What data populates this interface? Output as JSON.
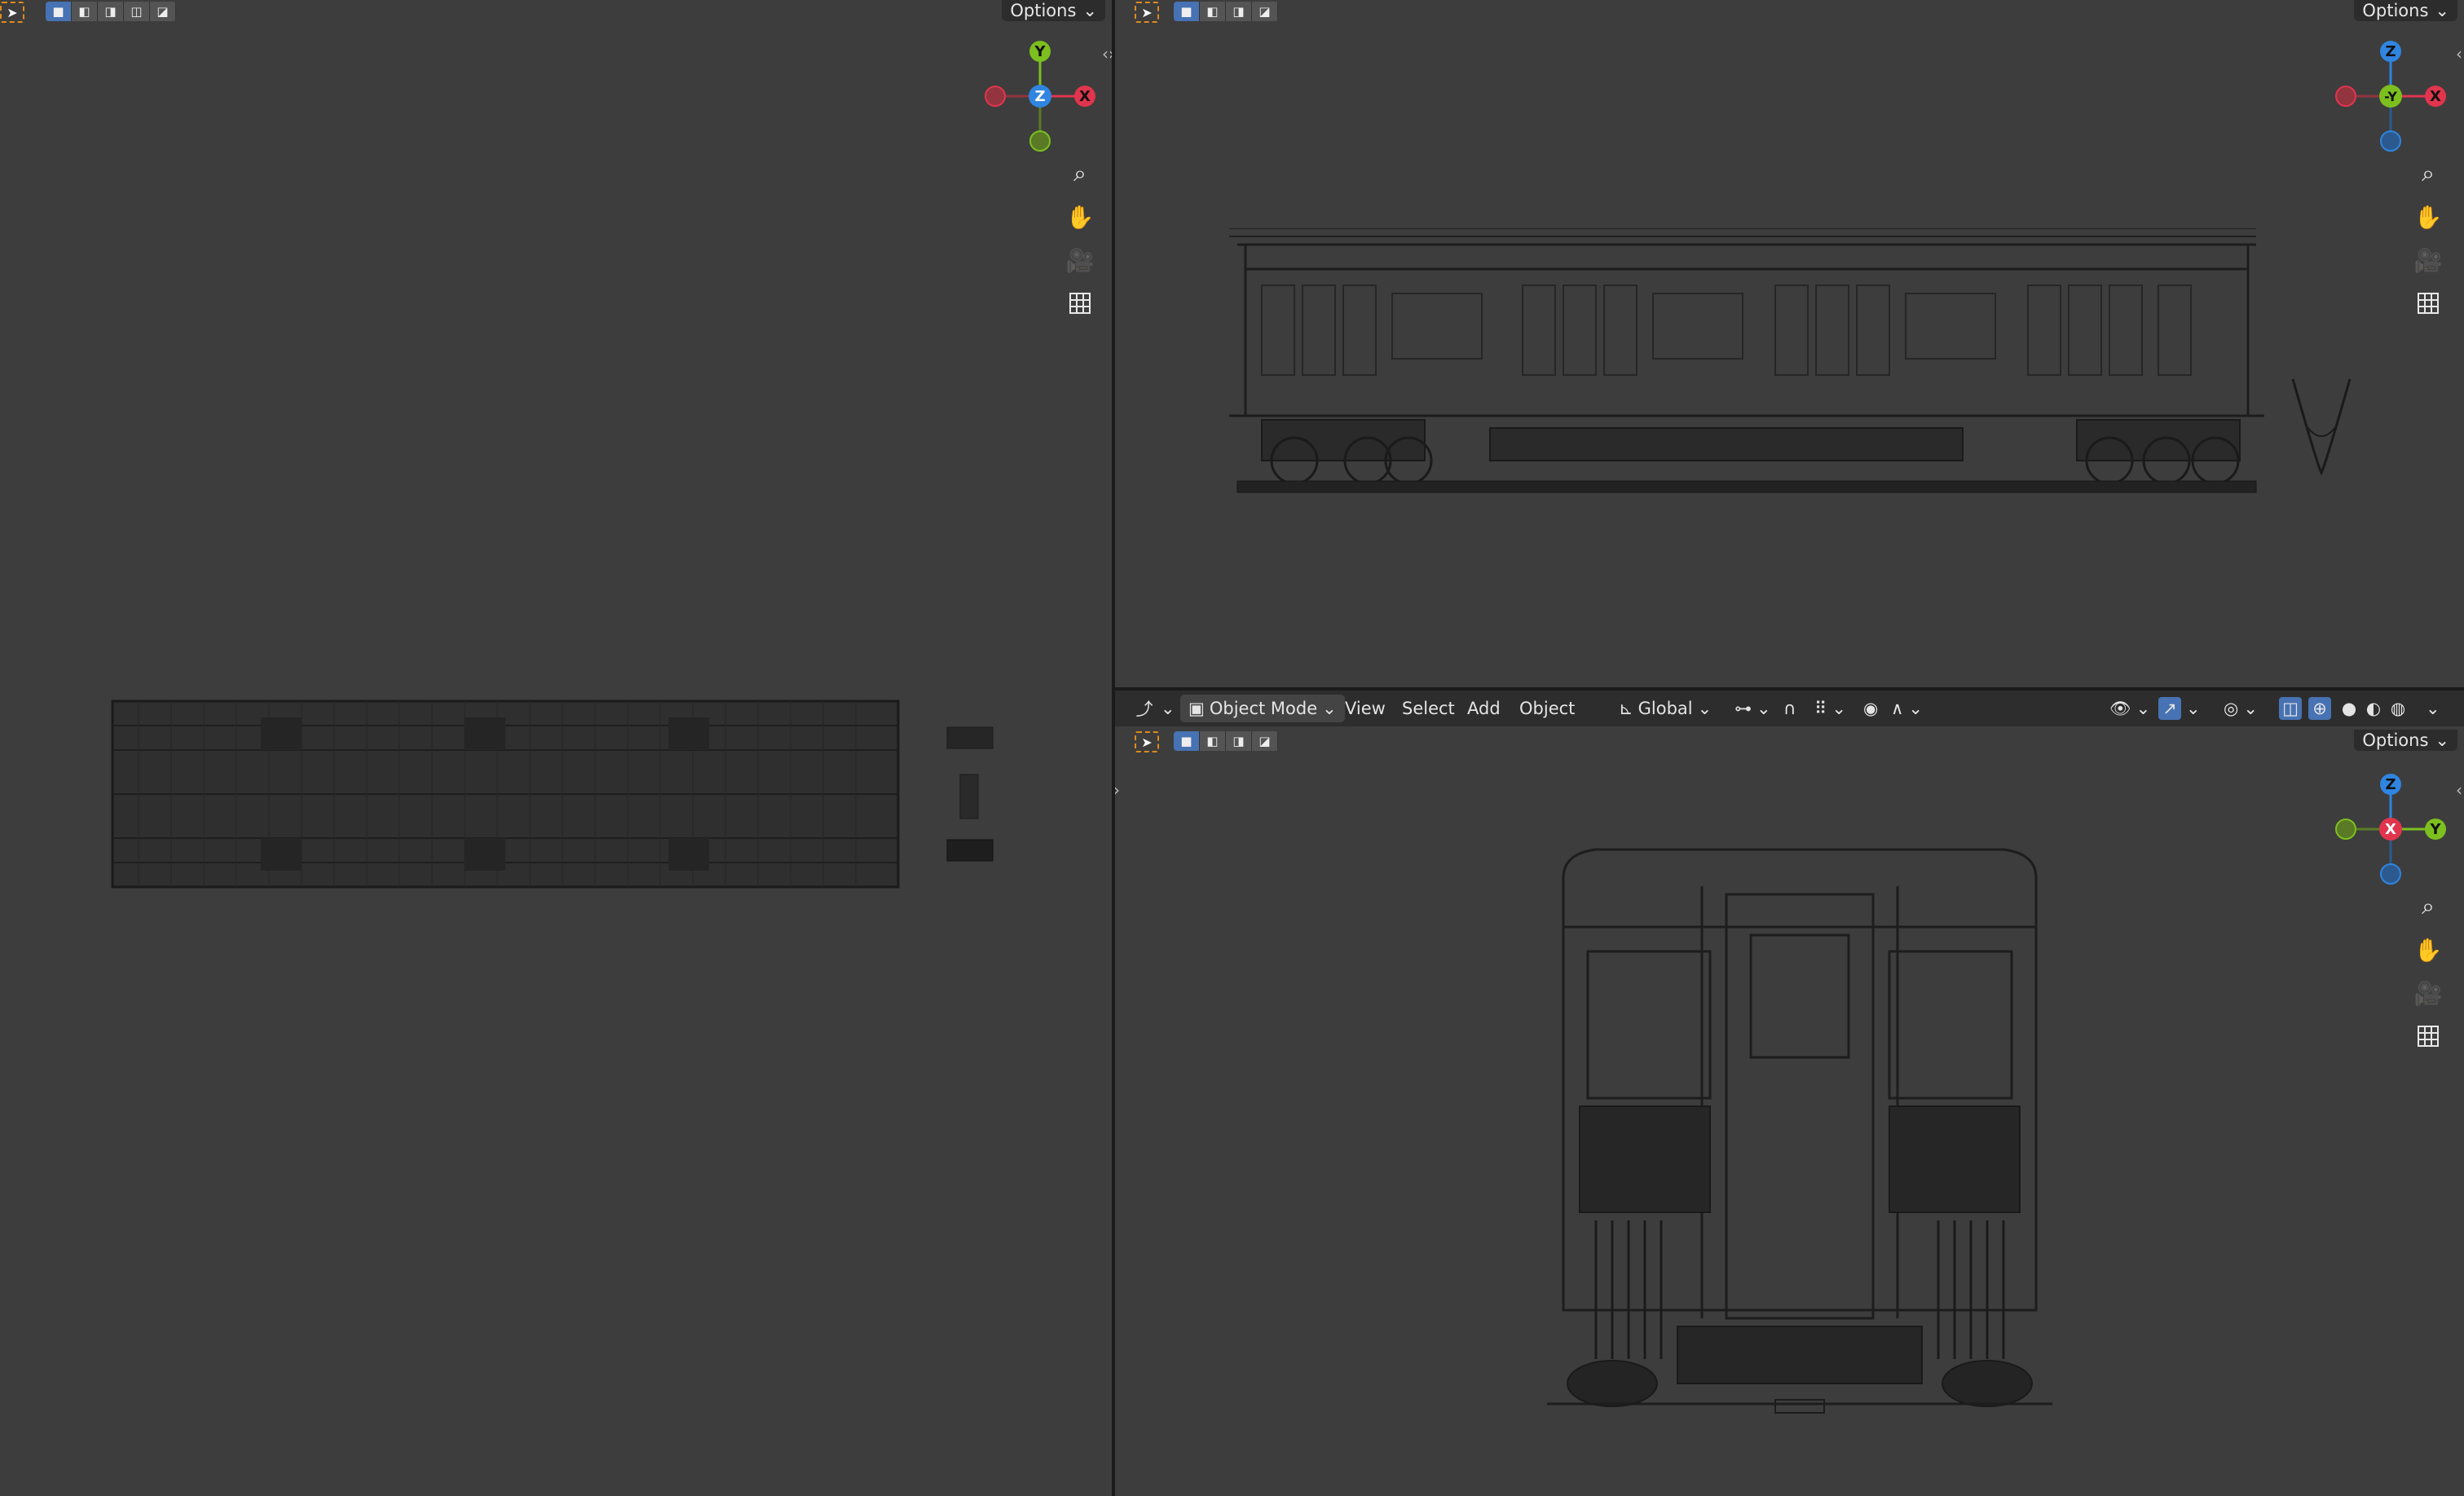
{
  "viewports": {
    "top": {
      "options_label": "Options",
      "gizmo": {
        "axis_up": "Y",
        "axis_center": "Z",
        "axis_right": "X"
      }
    },
    "front": {
      "options_label": "Options",
      "gizmo": {
        "axis_up": "Z",
        "axis_center": "-Y",
        "axis_right": "X"
      }
    },
    "side": {
      "options_label": "Options",
      "gizmo": {
        "axis_up": "Z",
        "axis_center": "X",
        "axis_right": "Y"
      }
    }
  },
  "header": {
    "mode_label": "Object Mode",
    "menu": {
      "view": "View",
      "select": "Select",
      "add": "Add",
      "object": "Object"
    },
    "orientation_label": "Global"
  },
  "icons": {
    "select": "cursor-arrow-icon",
    "zoom": "zoom-icon",
    "pan": "hand-icon",
    "camera": "camera-icon",
    "grid": "grid-icon"
  },
  "colors": {
    "viewport_bg": "#3d3d3d",
    "x_axis": "#e0354d",
    "y_axis": "#7cbf1f",
    "z_axis": "#2f85e0",
    "select_active": "#4772b3",
    "tool_dash": "#e08a1e"
  }
}
